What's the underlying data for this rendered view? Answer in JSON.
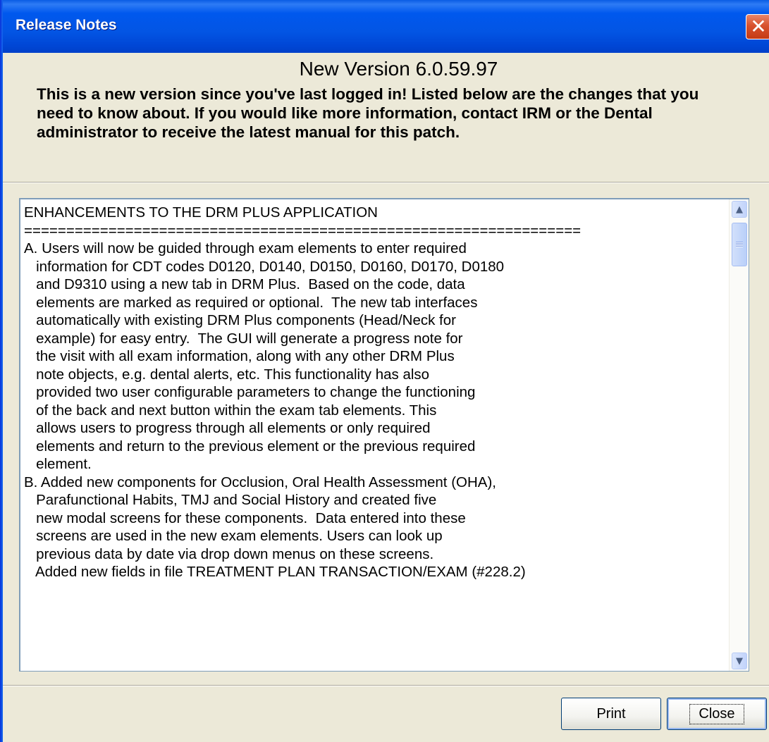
{
  "window": {
    "title": "Release Notes",
    "close_glyph": "✕"
  },
  "header": {
    "version_title": "New Version 6.0.59.97",
    "intro_text": "This is a new version since you've last logged in!  Listed below are the changes that you need to know about.  If you would like more information, contact IRM or the Dental administrator to receive the latest manual for this patch."
  },
  "notes": {
    "lines": [
      "ENHANCEMENTS TO THE DRM PLUS APPLICATION",
      "==================================================================",
      "A. Users will now be guided through exam elements to enter required",
      "   information for CDT codes D0120, D0140, D0150, D0160, D0170, D0180",
      "   and D9310 using a new tab in DRM Plus.  Based on the code, data",
      "   elements are marked as required or optional.  The new tab interfaces",
      "   automatically with existing DRM Plus components (Head/Neck for",
      "   example) for easy entry.  The GUI will generate a progress note for",
      "   the visit with all exam information, along with any other DRM Plus",
      "   note objects, e.g. dental alerts, etc. This functionality has also",
      "   provided two user configurable parameters to change the functioning",
      "   of the back and next button within the exam tab elements. This",
      "   allows users to progress through all elements or only required",
      "   elements and return to the previous element or the previous required",
      "   element.",
      "B. Added new components for Occlusion, Oral Health Assessment (OHA),",
      "   Parafunctional Habits, TMJ and Social History and created five",
      "   new modal screens for these components.  Data entered into these",
      "   screens are used in the new exam elements. Users can look up",
      "   previous data by date via drop down menus on these screens.",
      "   Added new fields in file TREATMENT PLAN TRANSACTION/EXAM (#228.2)"
    ]
  },
  "scrollbar": {
    "up_glyph": "▲",
    "down_glyph": "▼"
  },
  "buttons": {
    "print_label": "Print",
    "close_label": "Close"
  }
}
